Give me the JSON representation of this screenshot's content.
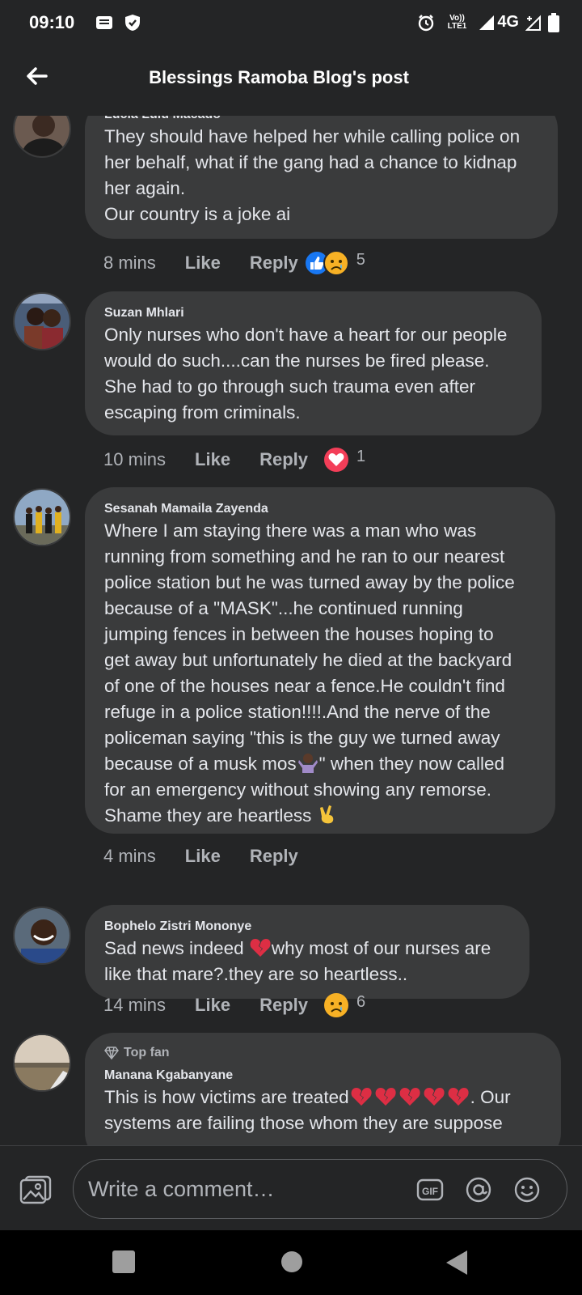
{
  "status_bar": {
    "time": "09:10",
    "network": "4G",
    "volte_top": "Vo))",
    "volte_bottom": "LTE1",
    "icons": [
      "message-icon",
      "shield-icon",
      "alarm-icon",
      "volte-icon",
      "signal-icon",
      "signal-icon-2",
      "battery-icon"
    ]
  },
  "header": {
    "title": "Blessings Ramoba Blog's post",
    "back_icon": "arrow-left-icon"
  },
  "comments": [
    {
      "author": "Lucia Lulu Macado",
      "lines": [
        "They should have helped her while calling police on",
        "her behalf, what if the gang had a chance to kidnap",
        "her again.",
        "Our country is a joke ai"
      ],
      "time": "8 mins",
      "like": "Like",
      "reply": "Reply",
      "reactions": [
        "like-reaction-icon",
        "sad-reaction-icon"
      ],
      "reaction_count": "5"
    },
    {
      "author": "Suzan Mhlari",
      "lines": [
        "Only nurses who don't have a heart for our people",
        "would do such....can the nurses be fired please.",
        "She had to go through such trauma even after",
        "escaping from criminals."
      ],
      "time": "10 mins",
      "like": "Like",
      "reply": "Reply",
      "reactions": [
        "love-reaction-icon"
      ],
      "reaction_count": "1"
    },
    {
      "author": "Sesanah Mamaila Zayenda",
      "lines": [
        "Where I am staying there was a man who was",
        "running from something and he ran to our nearest",
        "police station but he was turned away by the police",
        "because of a \"MASK\"...he continued running",
        "jumping fences in between the houses hoping to",
        "get away but unfortunately he died at the backyard",
        "of one of the houses near a fence.He couldn't find",
        "refuge in a police station!!!!.And the nerve of the",
        "policeman saying \"this is the guy we turned away",
        "because of a musk mos",
        "\" when they now called",
        "for an emergency without showing any remorse.",
        "Shame they are heartless "
      ],
      "time": "4 mins",
      "like": "Like",
      "reply": "Reply"
    },
    {
      "author": "Bophelo Zistri Mononye",
      "lines": [
        "Sad news indeed ",
        "why most of our nurses are",
        "like that mare?.they are so heartless.."
      ],
      "time": "14 mins",
      "like": "Like",
      "reply": "Reply",
      "reactions": [
        "sad-reaction-icon"
      ],
      "reaction_count": "6"
    },
    {
      "badge": "Top fan",
      "author": "Manana Kgabanyane",
      "lines": [
        "This is how victims are treated",
        ". Our",
        "systems are failing those whom they are suppose"
      ]
    }
  ],
  "composer": {
    "placeholder": "Write a comment…",
    "gif_label": "GIF",
    "mention_icon": "at-icon",
    "emoji_icon": "smiley-icon",
    "photo_icon": "photo-icon"
  },
  "navbar": {
    "icons": [
      "recent-apps-icon",
      "home-icon",
      "back-icon"
    ]
  },
  "colors": {
    "background": "#242526",
    "bubble": "#3a3b3c",
    "text": "#e4e6eb",
    "secondary_text": "#b0b3b8",
    "like_blue": "#1877f2",
    "love_red": "#f33e58",
    "sad_yellow": "#f7b125"
  }
}
